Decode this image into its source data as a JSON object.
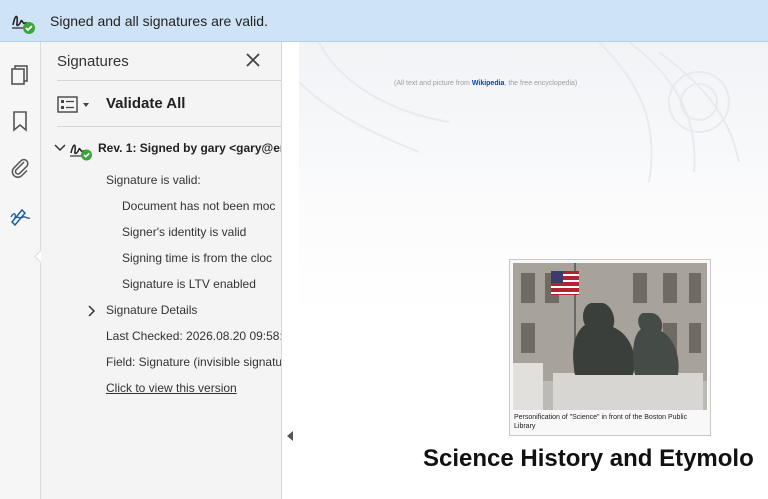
{
  "banner": {
    "message": "Signed and all signatures are valid.",
    "icon": "signature-valid-icon"
  },
  "sidebar_icons": [
    "pages-icon",
    "bookmark-icon",
    "attachment-icon",
    "signature-pen-icon"
  ],
  "panel": {
    "title": "Signatures",
    "validate_all": "Validate All",
    "revision": {
      "label": "Rev. 1: Signed by gary <gary@er",
      "status": "Signature is valid:",
      "checks": [
        "Document has not been moc",
        "Signer's identity is valid",
        "Signing time is from the cloc",
        "Signature is LTV enabled"
      ],
      "details_label": "Signature Details",
      "last_checked": "Last Checked: 2026.08.20 09:58:4",
      "field": "Field: Signature (invisible signatu",
      "view_version_link": "Click to view this version"
    }
  },
  "document": {
    "credit_prefix": "(All text and picture from",
    "credit_link": "Wikipedia",
    "credit_suffix": ", the free encyclopedia)",
    "figure_caption": "Personification of \"Science\" in front of the Boston Public Library",
    "heading": "Science History and Etymolo"
  },
  "colors": {
    "banner_bg": "#cfe3f6",
    "valid_green": "#3aa53a",
    "link_blue": "#0645ad"
  }
}
